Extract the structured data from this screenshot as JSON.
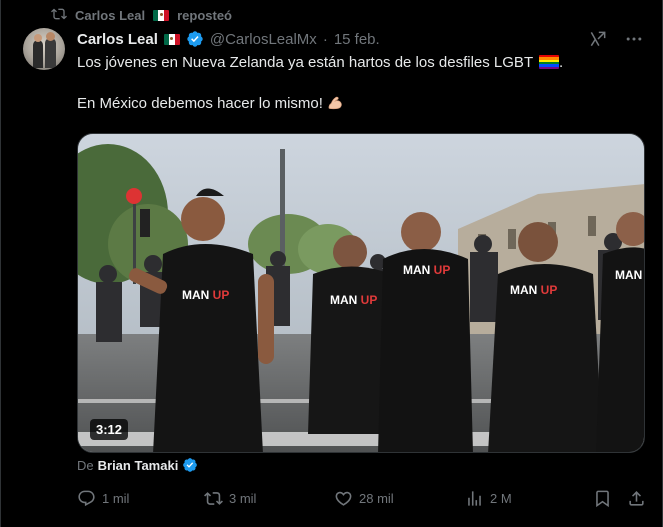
{
  "repost": {
    "reposter_name": "Carlos Leal",
    "suffix": "reposteó"
  },
  "post": {
    "display_name": "Carlos Leal",
    "handle": "@CarlosLealMx",
    "separator": "·",
    "date": "15 feb.",
    "text_line1": "Los jóvenes en Nueva Zelanda ya están hartos de los desfiles LGBT",
    "text_line2": "En México debemos hacer lo mismo!",
    "text_line1_end": "."
  },
  "media": {
    "duration": "3:12",
    "shirt_text": "MAN UP"
  },
  "source": {
    "prefix": "De",
    "author": "Brian Tamaki"
  },
  "actions": {
    "replies": "1 mil",
    "reposts": "3 mil",
    "likes": "28 mil",
    "views": "2 M"
  },
  "icons": {
    "repost": "repost-icon",
    "verified": "verified-badge-icon",
    "grok": "grok-icon",
    "more": "more-icon",
    "reply": "reply-icon",
    "like": "heart-icon",
    "views": "views-icon",
    "bookmark": "bookmark-icon",
    "share": "share-icon"
  },
  "colors": {
    "background": "#000000",
    "text": "#e7e9ea",
    "muted": "#71767b",
    "verified": "#1d9bf0",
    "border": "#2f3336"
  }
}
